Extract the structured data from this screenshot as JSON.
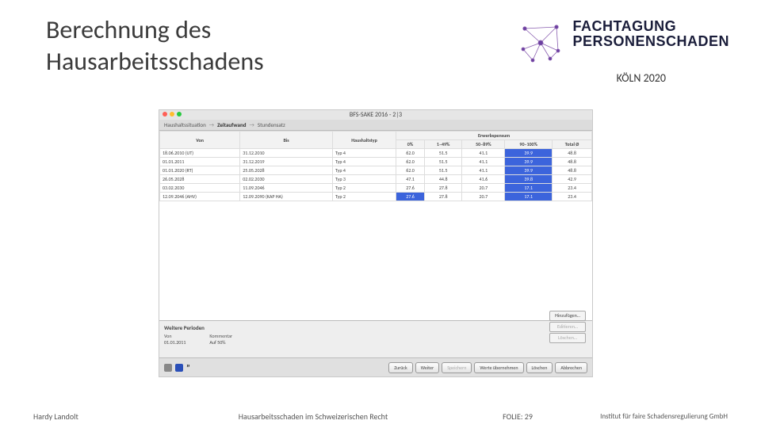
{
  "title": "Berechnung des\nHausarbeitsschadens",
  "brand_l1": "FACHTAGUNG",
  "brand_l2": "PERSONENSCHADEN",
  "location": "KÖLN 2020",
  "app": {
    "win_title": "BFS-SAKE 2016 - 2|3",
    "breadcrumb": [
      "Haushaltssituation",
      "→",
      "Zeitaufwand",
      "→",
      "Stundensatz"
    ],
    "bc_active_index": 2,
    "headers_top": [
      "Von",
      "Bis",
      "Haushaltstyp",
      "Erwerbspensum"
    ],
    "headers_sub": [
      "0%",
      "1–49%",
      "50–89%",
      "90–100%",
      "Total Ø"
    ],
    "rows": [
      {
        "von": "18.06.2010 (UT)",
        "bis": "31.12.2010",
        "typ": "Typ 4",
        "c": [
          "62.0",
          "51.5",
          "41.1",
          "39.9",
          "48.8"
        ],
        "hl": [
          3
        ]
      },
      {
        "von": "01.01.2011",
        "bis": "31.12.2019",
        "typ": "Typ 4",
        "c": [
          "62.0",
          "51.5",
          "41.1",
          "39.9",
          "48.8"
        ],
        "hl": [
          3
        ]
      },
      {
        "von": "01.01.2020 (RT)",
        "bis": "25.05.2028",
        "typ": "Typ 4",
        "c": [
          "62.0",
          "51.5",
          "41.1",
          "39.9",
          "48.8"
        ],
        "hl": [
          3
        ]
      },
      {
        "von": "26.05.2028",
        "bis": "02.02.2030",
        "typ": "Typ 3",
        "c": [
          "47.1",
          "44.8",
          "41.6",
          "39.8",
          "42.9"
        ],
        "hl": [
          3
        ]
      },
      {
        "von": "03.02.2030",
        "bis": "11.09.2046",
        "typ": "Typ 2",
        "c": [
          "27.6",
          "27.8",
          "20.7",
          "17.1",
          "23.4"
        ],
        "hl": [
          3
        ]
      },
      {
        "von": "12.09.2046 (AHV)",
        "bis": "12.09.2090 (KAP HA)",
        "typ": "Typ 2",
        "c": [
          "27.6",
          "27.8",
          "20.7",
          "17.1",
          "23.4"
        ],
        "hl": [
          0,
          3
        ]
      }
    ],
    "bottom_panel": {
      "title": "Weitere Perioden",
      "cols": [
        {
          "label": "Von",
          "value": "01.01.2011"
        },
        {
          "label": "Kommentar",
          "value": "Auf 50%"
        }
      ],
      "side_buttons": [
        "Hinzufügen…",
        "Editieren…",
        "Löschen…"
      ],
      "side_disabled": [
        false,
        true,
        true
      ]
    },
    "footer_buttons": [
      "Zurück",
      "Weiter",
      "Speichern",
      "Werte übernehmen",
      "Löschen",
      "Abbrechen"
    ],
    "footer_disabled": [
      false,
      false,
      true,
      false,
      false,
      false
    ]
  },
  "footer": {
    "left": "Hardy Landolt",
    "center": "Hausarbeitsschaden im Schweizerischen Recht",
    "page": "FOLIE: 29",
    "right": "Institut für faire Schadensregulierung GmbH"
  }
}
